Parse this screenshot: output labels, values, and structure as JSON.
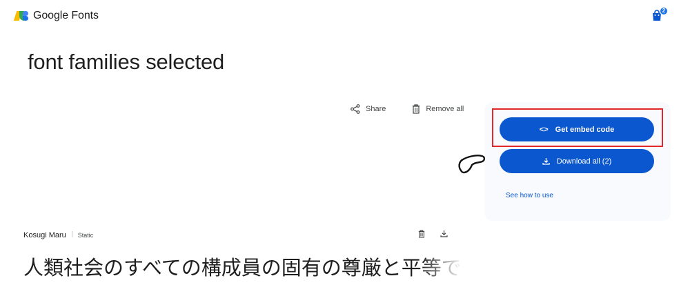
{
  "header": {
    "brand_google": "Google",
    "brand_fonts": "Fonts",
    "cart_count": "2",
    "logo_icon": "google-fonts-logo",
    "cart_icon": "shopping-bag-icon"
  },
  "main": {
    "title": "font families selected",
    "share_label": "Share",
    "remove_all_label": "Remove all"
  },
  "side_panel": {
    "embed_button_label": "Get embed code",
    "embed_icon_text": "<>",
    "download_button_label": "Download all (2)",
    "see_how_label": "See how to use",
    "accent_color": "#0b57d0",
    "highlight_color": "#e3262b"
  },
  "font_entry": {
    "name": "Kosugi Maru",
    "style_type": "Static",
    "sample_text": "人類社会のすべての構成員の固有の尊厳と平等で"
  }
}
